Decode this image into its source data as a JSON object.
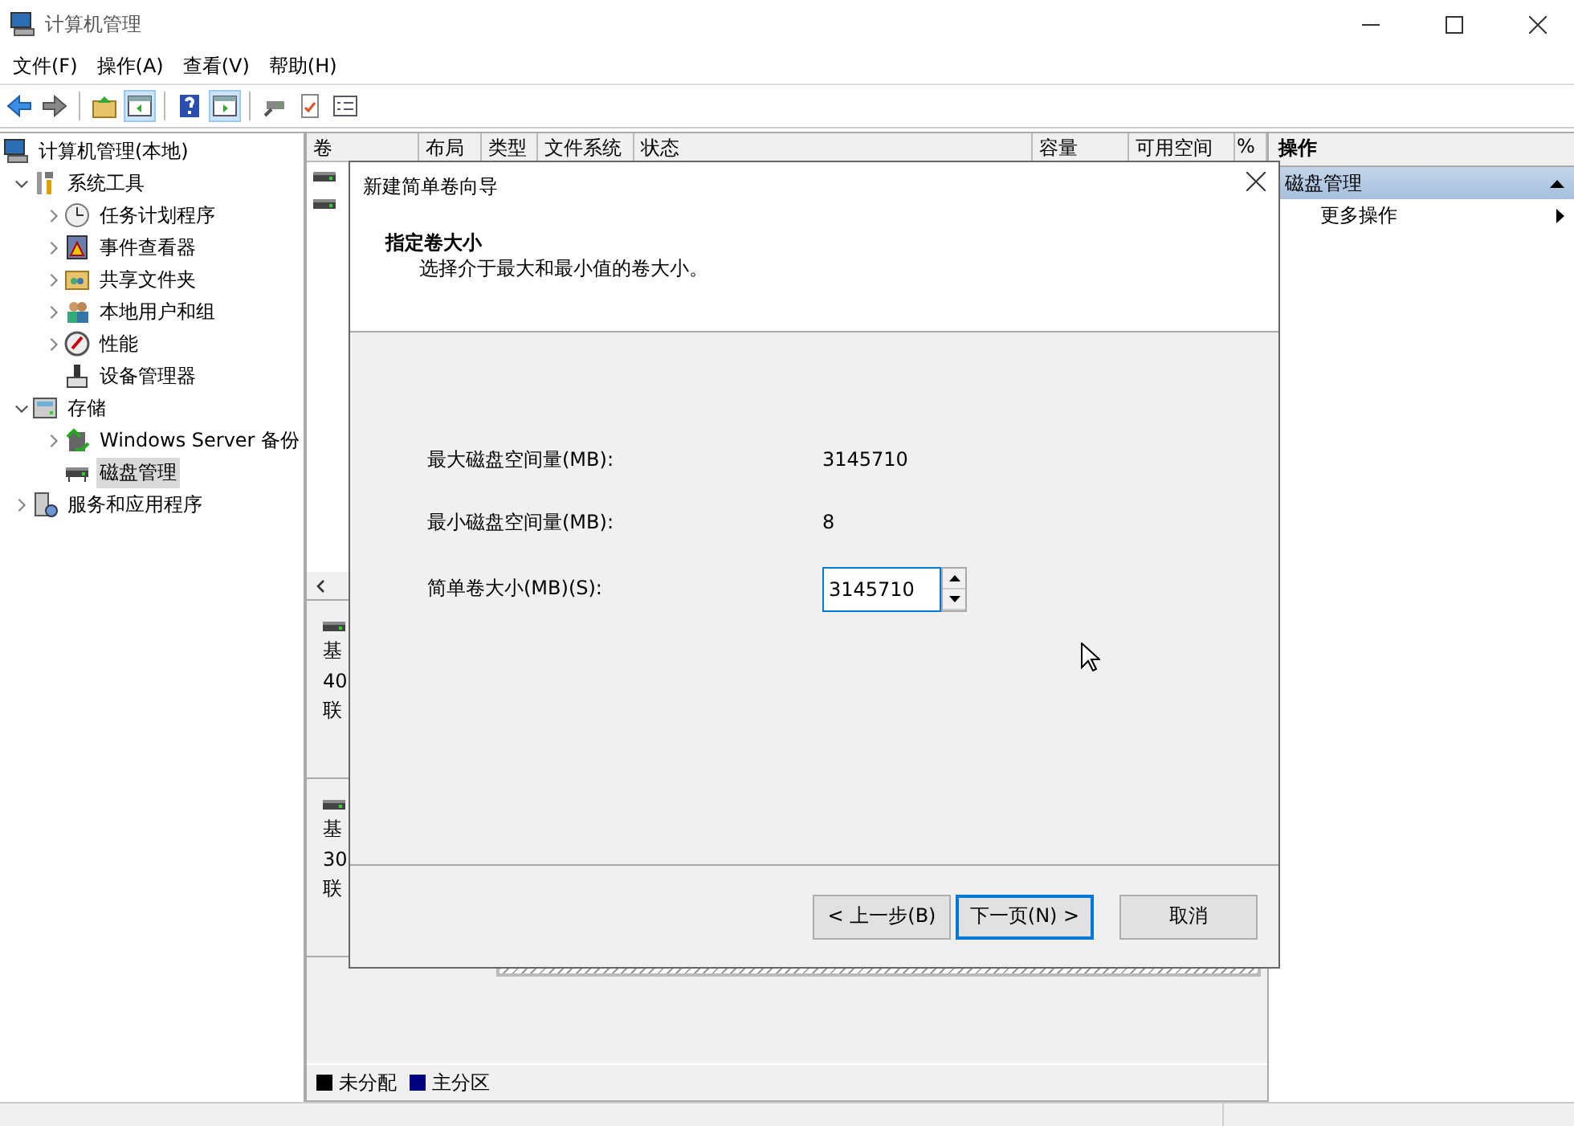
{
  "window": {
    "title": "计算机管理"
  },
  "menu": [
    "文件(F)",
    "操作(A)",
    "查看(V)",
    "帮助(H)"
  ],
  "toolbar": [
    {
      "kind": "back",
      "pressed": false
    },
    {
      "kind": "forward",
      "pressed": false
    },
    {
      "kind": "up",
      "pressed": false
    },
    {
      "kind": "tree",
      "pressed": true
    },
    {
      "kind": "help",
      "pressed": false
    },
    {
      "kind": "action",
      "pressed": true
    },
    {
      "kind": "connect",
      "pressed": false
    },
    {
      "kind": "check",
      "pressed": false
    },
    {
      "kind": "list",
      "pressed": false
    }
  ],
  "tree": [
    {
      "label": "计算机管理(本地)",
      "kind": "computer",
      "selected": false,
      "children": [
        {
          "label": "系统工具",
          "kind": "tools",
          "expanded": true,
          "selected": false,
          "children": [
            {
              "label": "任务计划程序",
              "kind": "clock",
              "expanded": false,
              "selected": false
            },
            {
              "label": "事件查看器",
              "kind": "event",
              "expanded": false,
              "selected": false
            },
            {
              "label": "共享文件夹",
              "kind": "share",
              "expanded": false,
              "selected": false
            },
            {
              "label": "本地用户和组",
              "kind": "users",
              "expanded": false,
              "selected": false
            },
            {
              "label": "性能",
              "kind": "perf",
              "expanded": false,
              "selected": false
            },
            {
              "label": "设备管理器",
              "kind": "device",
              "selected": false
            }
          ]
        },
        {
          "label": "存储",
          "kind": "storage",
          "expanded": true,
          "selected": false,
          "children": [
            {
              "label": "Windows Server 备份",
              "kind": "backup",
              "expanded": false,
              "selected": false
            },
            {
              "label": "磁盘管理",
              "kind": "disk",
              "selected": true
            }
          ]
        },
        {
          "label": "服务和应用程序",
          "kind": "services",
          "expanded": false,
          "selected": false
        }
      ]
    }
  ],
  "volume_table": {
    "columns": [
      "卷",
      "布局",
      "类型",
      "文件系统",
      "状态",
      "容量",
      "可用空间",
      "%"
    ]
  },
  "disks": [
    {
      "lines": [
        "基",
        "40",
        "联"
      ]
    },
    {
      "lines": [
        "基",
        "30",
        "联"
      ]
    }
  ],
  "legend": [
    {
      "label": "未分配",
      "color": "#000000"
    },
    {
      "label": "主分区",
      "color": "#000080"
    }
  ],
  "actions": {
    "title": "操作",
    "section": "磁盘管理",
    "items": [
      "更多操作"
    ]
  },
  "dialog": {
    "title": "新建简单卷向导",
    "heading": "指定卷大小",
    "subheading": "选择介于最大和最小值的卷大小。",
    "fields": [
      {
        "kind": "readout",
        "label": "最大磁盘空间量(MB):",
        "value": "3145710"
      },
      {
        "kind": "readout",
        "label": "最小磁盘空间量(MB):",
        "value": "8"
      },
      {
        "kind": "spinner",
        "label": "简单卷大小(MB)(S):",
        "value": "3145710"
      }
    ],
    "buttons": [
      {
        "label": "< 上一步(B)",
        "default": false
      },
      {
        "label": "下一页(N) >",
        "default": true
      },
      {
        "label": "取消",
        "default": false
      }
    ]
  }
}
